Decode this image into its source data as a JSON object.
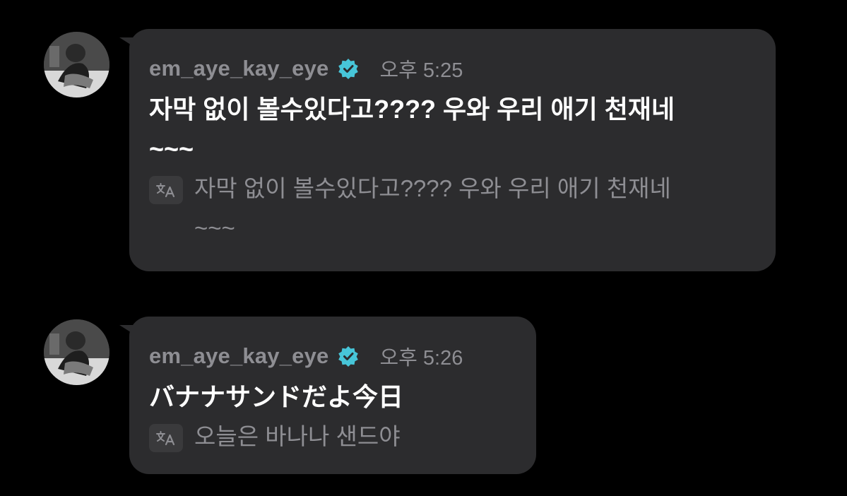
{
  "messages": [
    {
      "username": "em_aye_kay_eye",
      "time": "오후 5:25",
      "text": "자막 없이 볼수있다고???? 우와 우리 애기 천재네\n~~~",
      "translation": "자막 없이 볼수있다고???? 우와 우리 애기 천재네\n~~~",
      "translate_icon": "translate-icon"
    },
    {
      "username": "em_aye_kay_eye",
      "time": "오후 5:26",
      "text": "バナナサンドだよ今日",
      "translation": "오늘은 바나나 샌드야",
      "translate_icon": "translate-icon"
    }
  ],
  "colors": {
    "background": "#000000",
    "bubble": "#2c2c2e",
    "muted_text": "#8e8e93",
    "message_text": "#ffffff",
    "verified_badge": "#47c5d8"
  }
}
